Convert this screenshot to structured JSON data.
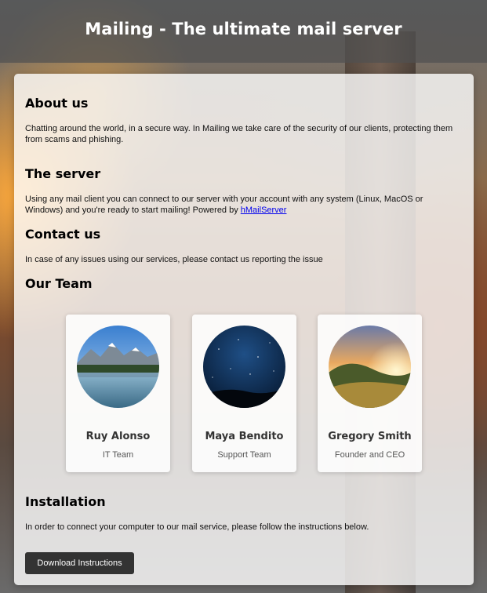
{
  "header": {
    "title": "Mailing - The ultimate mail server"
  },
  "about": {
    "heading": "About us",
    "text": "Chatting around the world, in a secure way. In Mailing we take care of the security of our clients, protecting them from scams and phishing."
  },
  "server": {
    "heading": "The server",
    "text_before": "Using any mail client you can connect to our server with your account with any system (Linux, MacOS or Windows) and you're ready to start mailing! Powered by ",
    "link_label": "hMailServer"
  },
  "contact": {
    "heading": "Contact us",
    "text": "In case of any issues using our services, please contact us reporting the issue"
  },
  "team": {
    "heading": "Our Team",
    "members": [
      {
        "name": "Ruy Alonso",
        "role": "IT Team"
      },
      {
        "name": "Maya Bendito",
        "role": "Support Team"
      },
      {
        "name": "Gregory Smith",
        "role": "Founder and CEO"
      }
    ]
  },
  "installation": {
    "heading": "Installation",
    "text": "In order to connect your computer to our mail service, please follow the instructions below.",
    "button_label": "Download Instructions"
  }
}
